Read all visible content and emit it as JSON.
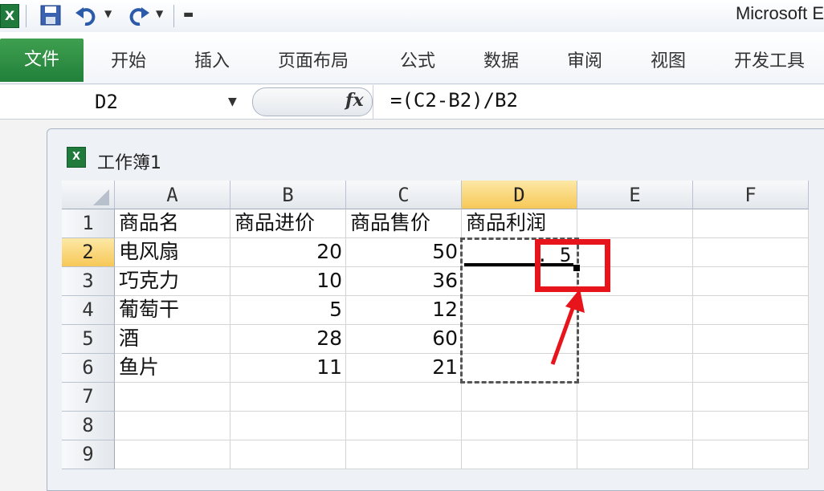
{
  "app": {
    "title": "Microsoft E"
  },
  "ribbon": {
    "file_tab": "文件",
    "tabs": [
      "开始",
      "插入",
      "页面布局",
      "公式",
      "数据",
      "审阅",
      "视图",
      "开发工具"
    ]
  },
  "formula_bar": {
    "name_box": "D2",
    "fx_label": "fx",
    "formula": "=(C2-B2)/B2"
  },
  "workbook": {
    "title": "工作簿1"
  },
  "sheet": {
    "columns": [
      "A",
      "B",
      "C",
      "D",
      "E",
      "F"
    ],
    "rows": [
      "1",
      "2",
      "3",
      "4",
      "5",
      "6",
      "7",
      "8",
      "9"
    ],
    "header": [
      "商品名",
      "商品进价",
      "商品售价",
      "商品利润"
    ],
    "data": [
      {
        "name": "电风扇",
        "cost": "20",
        "price": "50"
      },
      {
        "name": "巧克力",
        "cost": "10",
        "price": "36"
      },
      {
        "name": "葡萄干",
        "cost": "5",
        "price": "12"
      },
      {
        "name": "酒",
        "cost": "28",
        "price": "60"
      },
      {
        "name": "鱼片",
        "cost": "11",
        "price": "21"
      }
    ],
    "active_cell_partial": ". 5"
  },
  "colors": {
    "accent_file": "#21803a",
    "selection_header": "#f7c857",
    "annotation": "#e8141b"
  }
}
